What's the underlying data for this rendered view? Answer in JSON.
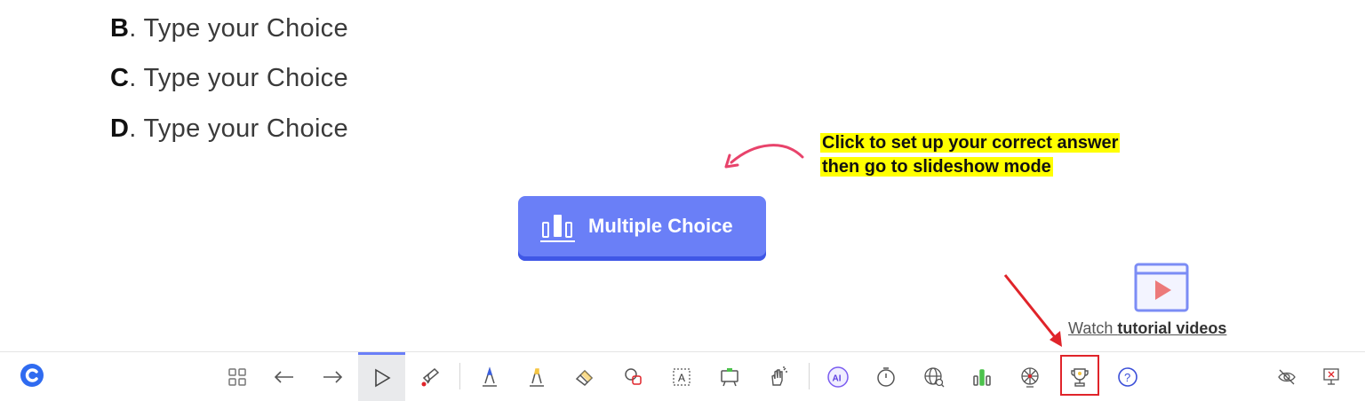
{
  "choices": [
    {
      "letter": "B",
      "text": ". Type your Choice"
    },
    {
      "letter": "C",
      "text": ". Type your Choice"
    },
    {
      "letter": "D",
      "text": ". Type your Choice"
    }
  ],
  "callout": {
    "line1": "Click to set up your correct answer",
    "line2": "then go to slideshow mode"
  },
  "multiple_choice_button": {
    "label": "Multiple Choice"
  },
  "tutorial": {
    "prefix": "Watch ",
    "bold": "tutorial videos"
  },
  "colors": {
    "accent": "#6a7ff7",
    "highlight": "#ffff00",
    "annotation_red": "#e0242a",
    "callout_arrow": "#e8436b"
  },
  "toolbar": {
    "icons": [
      "app-logo-icon",
      "grid-icon",
      "arrow-left-icon",
      "arrow-right-icon",
      "pointer-icon",
      "laser-pen-icon",
      "pen-icon",
      "highlighter-icon",
      "eraser-icon",
      "shapes-icon",
      "text-box-icon",
      "whiteboard-icon",
      "hand-raise-icon",
      "ai-icon",
      "timer-icon",
      "web-browser-icon",
      "bar-chart-icon",
      "spinner-wheel-icon",
      "trophy-icon",
      "help-icon",
      "hide-icon",
      "exit-slideshow-icon"
    ],
    "active": "pointer-icon",
    "highlighted": "trophy-icon"
  }
}
